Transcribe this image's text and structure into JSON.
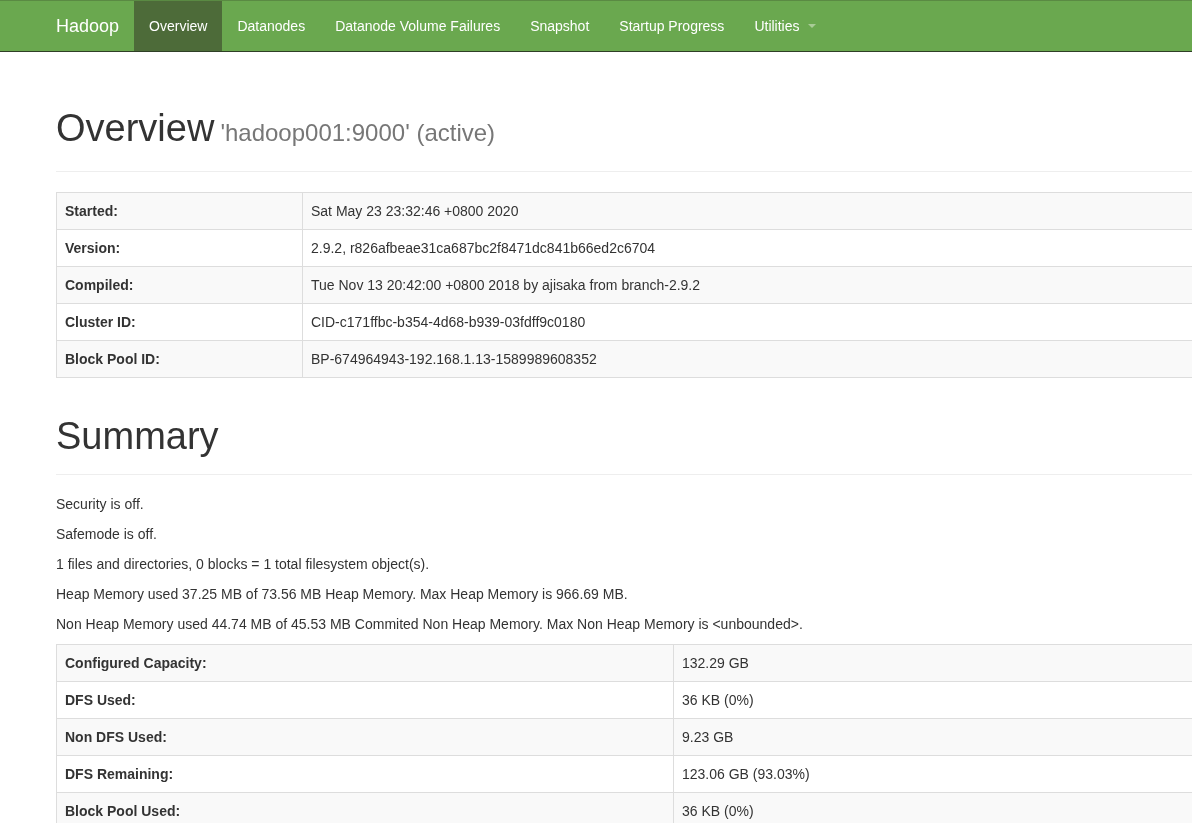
{
  "navbar": {
    "brand": "Hadoop",
    "items": [
      {
        "label": "Overview",
        "selected": true,
        "kind": "link"
      },
      {
        "label": "Datanodes",
        "selected": false,
        "kind": "link"
      },
      {
        "label": "Datanode Volume Failures",
        "selected": false,
        "kind": "link"
      },
      {
        "label": "Snapshot",
        "selected": false,
        "kind": "link"
      },
      {
        "label": "Startup Progress",
        "selected": false,
        "kind": "link"
      },
      {
        "label": "Utilities",
        "selected": false,
        "kind": "dropdown"
      }
    ]
  },
  "overview": {
    "title": "Overview",
    "subtitle": "'hadoop001:9000' (active)",
    "table": [
      {
        "label": "Started:",
        "value": "Sat May 23 23:32:46 +0800 2020"
      },
      {
        "label": "Version:",
        "value": "2.9.2, r826afbeae31ca687bc2f8471dc841b66ed2c6704"
      },
      {
        "label": "Compiled:",
        "value": "Tue Nov 13 20:42:00 +0800 2018 by ajisaka from branch-2.9.2"
      },
      {
        "label": "Cluster ID:",
        "value": "CID-c171ffbc-b354-4d68-b939-03fdff9c0180"
      },
      {
        "label": "Block Pool ID:",
        "value": "BP-674964943-192.168.1.13-1589989608352"
      }
    ]
  },
  "summary": {
    "title": "Summary",
    "lines": [
      "Security is off.",
      "Safemode is off.",
      "1 files and directories, 0 blocks = 1 total filesystem object(s).",
      "Heap Memory used 37.25 MB of 73.56 MB Heap Memory. Max Heap Memory is 966.69 MB.",
      "Non Heap Memory used 44.74 MB of 45.53 MB Commited Non Heap Memory. Max Non Heap Memory is <unbounded>."
    ],
    "table": [
      {
        "label": "Configured Capacity:",
        "value": "132.29 GB"
      },
      {
        "label": "DFS Used:",
        "value": "36 KB (0%)"
      },
      {
        "label": "Non DFS Used:",
        "value": "9.23 GB"
      },
      {
        "label": "DFS Remaining:",
        "value": "123.06 GB (93.03%)"
      },
      {
        "label": "Block Pool Used:",
        "value": "36 KB (0%)"
      }
    ]
  }
}
